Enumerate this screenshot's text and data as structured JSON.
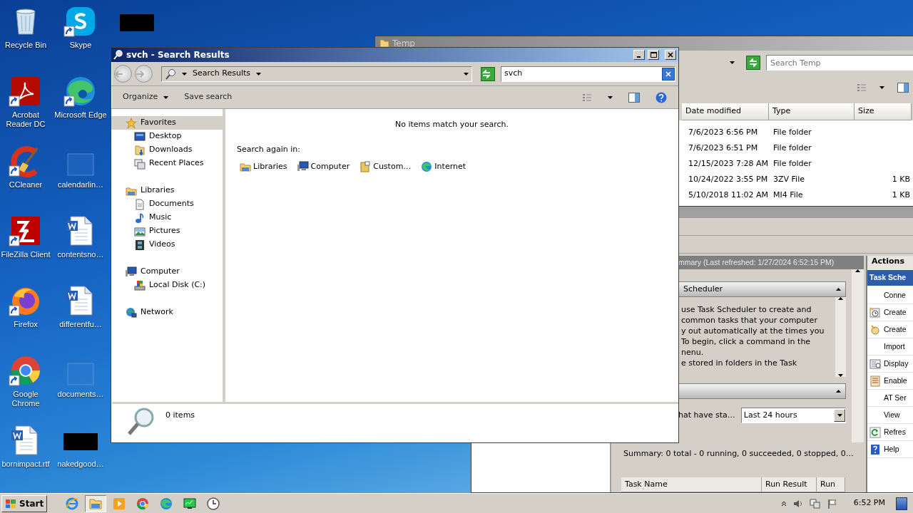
{
  "desktop": {
    "icons": [
      {
        "kind": "recycle-bin",
        "label": "Recycle Bin",
        "shortcut": false
      },
      {
        "kind": "acrobat",
        "label": "Acrobat Reader DC",
        "shortcut": true
      },
      {
        "kind": "ccleaner",
        "label": "CCleaner",
        "shortcut": true
      },
      {
        "kind": "filezilla",
        "label": "FileZilla Client",
        "shortcut": true
      },
      {
        "kind": "firefox",
        "label": "Firefox",
        "shortcut": true
      },
      {
        "kind": "chrome",
        "label": "Google Chrome",
        "shortcut": true
      },
      {
        "kind": "word",
        "label": "bornimpact.rtf",
        "shortcut": false
      },
      {
        "kind": "skype",
        "label": "Skype",
        "shortcut": true
      },
      {
        "kind": "edge",
        "label": "Microsoft Edge",
        "shortcut": true
      },
      {
        "kind": "blank",
        "label": "calendarlin…",
        "shortcut": false
      },
      {
        "kind": "word",
        "label": "contentsno…",
        "shortcut": false
      },
      {
        "kind": "word",
        "label": "differentfu…",
        "shortcut": false
      },
      {
        "kind": "blank",
        "label": "documents…",
        "shortcut": false
      },
      {
        "kind": "thumbnail",
        "label": "nakedgood…",
        "shortcut": false
      },
      {
        "kind": "thumbnail",
        "shortcut": false
      }
    ]
  },
  "scheduler_window": {
    "summary_header": "mmary (Last refreshed: 1/27/2024 6:52:15 PM)",
    "section_title": "Scheduler",
    "overview_lines": [
      "use Task Scheduler to create and",
      "common tasks that your computer",
      "y out automatically at the times you",
      "To begin, click a command in the",
      "nenu.",
      "e stored in folders in the Task"
    ],
    "filter_label": "hat have sta…",
    "filter_value": "Last 24 hours",
    "summary": "Summary: 0 total - 0 running, 0 succeeded, 0 stopped, 0…",
    "columns": [
      "Task Name",
      "Run Result",
      "Run"
    ],
    "actions_title": "Actions",
    "actions_group": "Task Sche",
    "actions": [
      {
        "label": "Conne",
        "kind": "plain"
      },
      {
        "label": "Create",
        "kind": "clock"
      },
      {
        "label": "Create",
        "kind": "spark"
      },
      {
        "label": "Import",
        "kind": "plain"
      },
      {
        "label": "Display",
        "kind": "list"
      },
      {
        "label": "Enable",
        "kind": "log"
      },
      {
        "label": "AT Ser",
        "kind": "plain"
      },
      {
        "label": "View",
        "kind": "plain"
      },
      {
        "label": "Refres",
        "kind": "refresh"
      },
      {
        "label": "Help",
        "kind": "help"
      }
    ]
  },
  "temp_window": {
    "title": "Temp",
    "search_placeholder": "Search Temp",
    "columns": [
      "Date modified",
      "Type",
      "Size"
    ],
    "rows": [
      {
        "date": "7/6/2023 6:56 PM",
        "type": "File folder"
      },
      {
        "date": "7/6/2023 6:51 PM",
        "type": "File folder"
      },
      {
        "date": "12/15/2023 7:28 AM",
        "type": "File folder"
      },
      {
        "date": "10/24/2022 3:55 PM",
        "type": "3ZV File",
        "size": "1 KB"
      },
      {
        "date": "5/10/2018 11:02 AM",
        "type": "MI4 File",
        "size": "1 KB"
      }
    ]
  },
  "search_window": {
    "title": "svch - Search Results",
    "address": "Search Results",
    "search_value": "svch",
    "toolbar": [
      {
        "label": "Organize",
        "dropdown": true
      },
      {
        "label": "Save search",
        "dropdown": false
      }
    ],
    "nav": [
      {
        "label": "Favorites",
        "kind": "star",
        "selected": true,
        "children": [
          {
            "label": "Desktop",
            "kind": "desktop",
            "selected": false
          },
          {
            "label": "Downloads",
            "kind": "downloads",
            "selected": false
          },
          {
            "label": "Recent Places",
            "kind": "recent",
            "selected": false
          }
        ]
      },
      {
        "label": "Libraries",
        "kind": "libraries",
        "selected": false,
        "children": [
          {
            "label": "Documents",
            "kind": "documents",
            "selected": false
          },
          {
            "label": "Music",
            "kind": "music",
            "selected": false
          },
          {
            "label": "Pictures",
            "kind": "pictures",
            "selected": false
          },
          {
            "label": "Videos",
            "kind": "videos",
            "selected": false
          }
        ]
      },
      {
        "label": "Computer",
        "kind": "computer",
        "selected": false,
        "children": [
          {
            "label": "Local Disk (C:)",
            "kind": "disk",
            "selected": false
          }
        ]
      },
      {
        "label": "Network",
        "kind": "network",
        "selected": false
      }
    ],
    "message": "No items match your search.",
    "search_again_label": "Search again in:",
    "search_again": [
      {
        "label": "Libraries",
        "kind": "libraries"
      },
      {
        "label": "Computer",
        "kind": "computer"
      },
      {
        "label": "Custom…",
        "kind": "custom"
      },
      {
        "label": "Internet",
        "kind": "internet"
      }
    ],
    "item_count": "0 items"
  },
  "taskbar": {
    "start": "Start",
    "apps": [
      {
        "kind": "ie",
        "active": false
      },
      {
        "kind": "explorer",
        "active": true
      },
      {
        "kind": "media",
        "active": false
      },
      {
        "kind": "chrome",
        "active": false
      },
      {
        "kind": "edge",
        "active": false
      },
      {
        "kind": "monitor",
        "active": false
      },
      {
        "kind": "clock",
        "active": false
      }
    ],
    "clock": "6:52 PM"
  }
}
